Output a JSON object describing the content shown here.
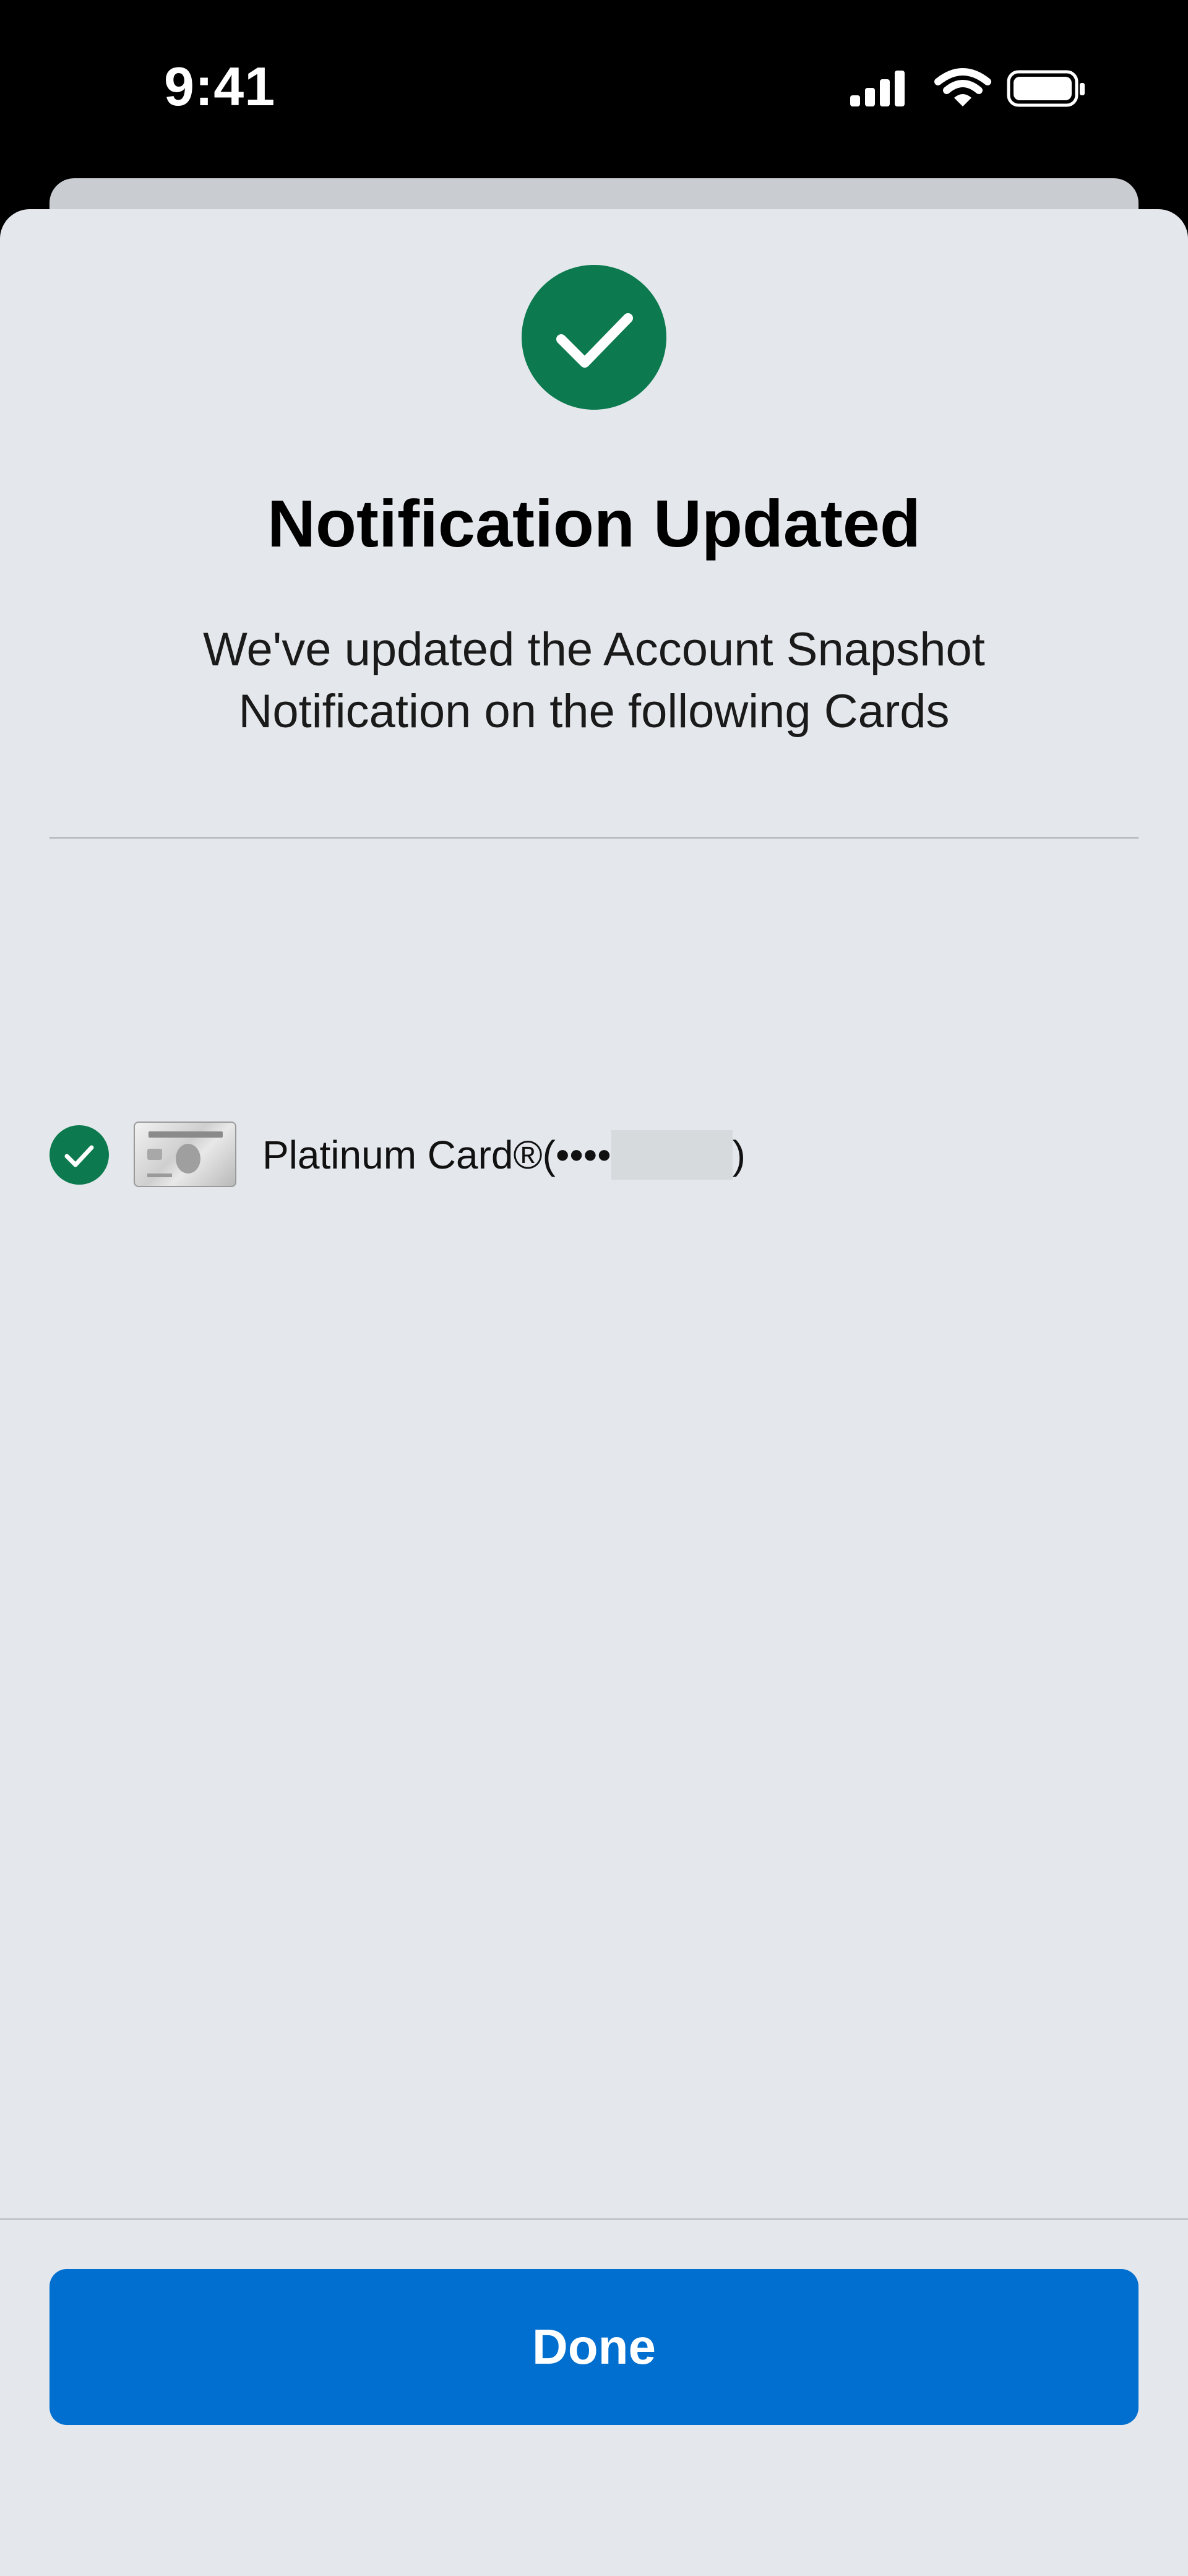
{
  "status_bar": {
    "time": "9:41",
    "icons": [
      "signal-bars-icon",
      "wifi-icon",
      "battery-icon"
    ]
  },
  "dialog": {
    "icon": "checkmark-circle-icon",
    "title": "Notification Updated",
    "message": "We've updated the Account Snapshot Notification on the following Cards"
  },
  "cards": [
    {
      "status_icon": "checkmark-circle-icon",
      "image": "platinum-card-thumbnail",
      "name": "Platinum Card®",
      "number_prefix": " (••••",
      "number_suffix": ")"
    }
  ],
  "actions": {
    "done_label": "Done"
  },
  "colors": {
    "success_green": "#0c7a4e",
    "primary_blue": "#006fcf",
    "sheet_background": "#e4e8ec",
    "status_bar_background": "#000000"
  }
}
